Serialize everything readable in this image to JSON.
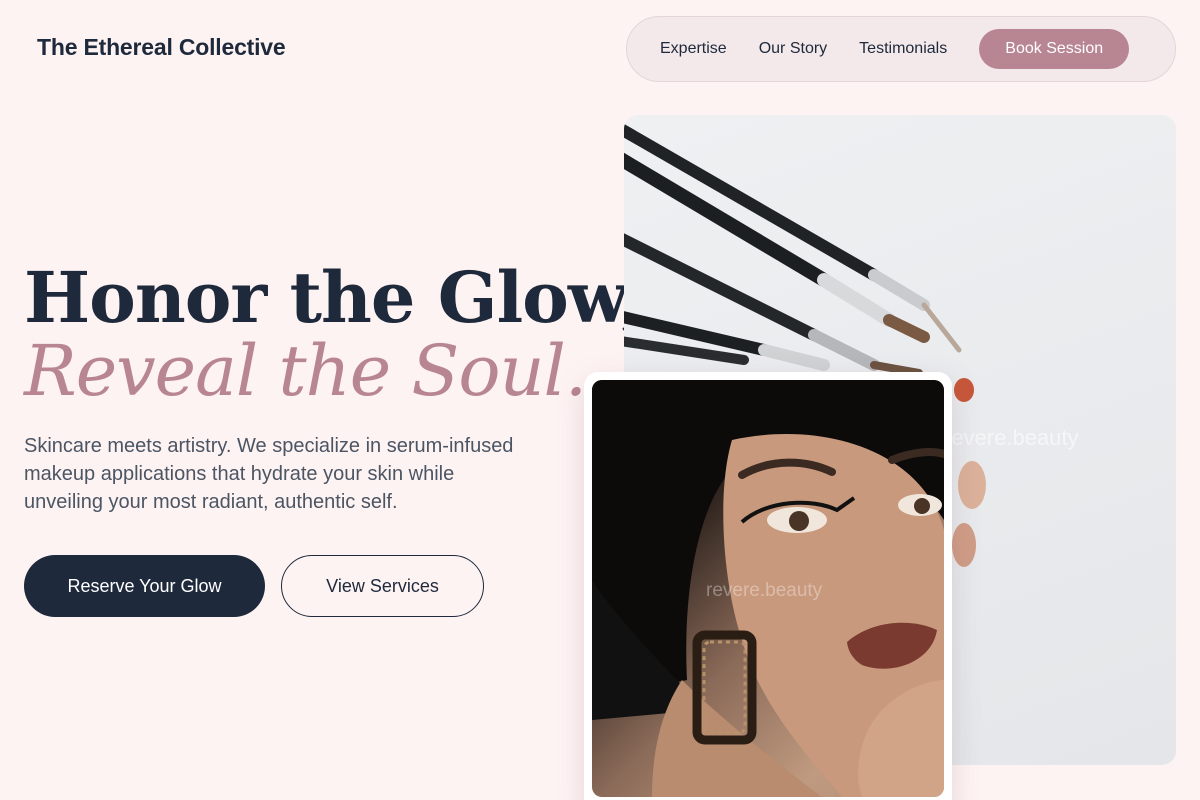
{
  "header": {
    "brand": "The Ethereal Collective",
    "nav": [
      {
        "label": "Expertise"
      },
      {
        "label": "Our Story"
      },
      {
        "label": "Testimonials"
      }
    ],
    "cta_label": "Book Session"
  },
  "hero": {
    "headline_line1": "Honor the Glow,",
    "headline_line2": "Reveal the Soul.",
    "subtext": "Skincare meets artistry. We specialize in serum-infused makeup applications that hydrate your skin while unveiling your most radiant, authentic self.",
    "primary_button": "Reserve Your Glow",
    "secondary_button": "View Services"
  },
  "images": {
    "brushes_watermark": "revere.beauty",
    "portrait_watermark": "revere.beauty"
  },
  "colors": {
    "background": "#fef3f3",
    "ink": "#1e293b",
    "accent": "#b88593",
    "nav_bg": "#f3e8ea"
  }
}
